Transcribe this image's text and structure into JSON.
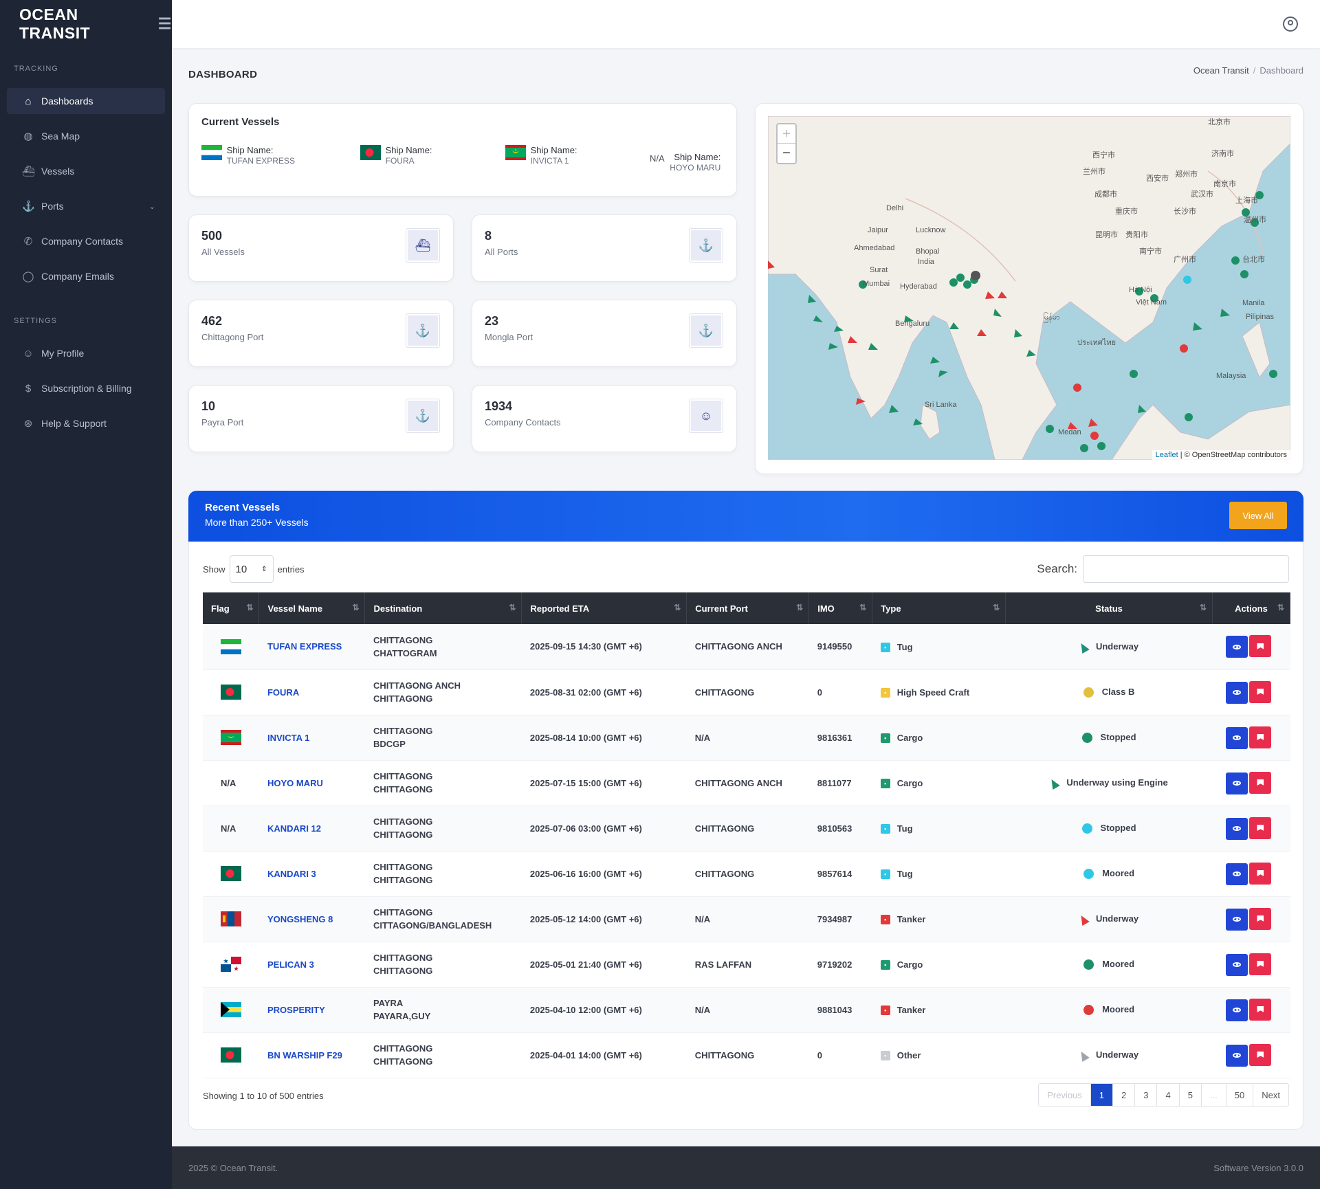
{
  "brand": {
    "name": "OCEAN TRANSIT"
  },
  "sidebar": {
    "sections": [
      {
        "title": "TRACKING"
      },
      {
        "title": "SETTINGS"
      }
    ],
    "tracking_items": [
      {
        "label": "Dashboards",
        "icon": "home-icon"
      },
      {
        "label": "Sea Map",
        "icon": "globe-icon"
      },
      {
        "label": "Vessels",
        "icon": "ship-icon"
      },
      {
        "label": "Ports",
        "icon": "anchor-icon"
      },
      {
        "label": "Company Contacts",
        "icon": "phone-icon"
      },
      {
        "label": "Company Emails",
        "icon": "chat-icon"
      }
    ],
    "settings_items": [
      {
        "label": "My Profile",
        "icon": "user-icon"
      },
      {
        "label": "Subscription & Billing",
        "icon": "dollar-icon"
      },
      {
        "label": "Help & Support",
        "icon": "lifebuoy-icon"
      }
    ]
  },
  "header": {
    "page_title": "DASHBOARD",
    "breadcrumb": [
      "Ocean Transit",
      "Dashboard"
    ]
  },
  "current_vessels": {
    "title": "Current Vessels",
    "ship_label": "Ship Name:",
    "items": [
      {
        "name": "TUFAN EXPRESS",
        "flag": "sierra-leone"
      },
      {
        "name": "FOURA",
        "flag": "bangladesh"
      },
      {
        "name": "INVICTA 1",
        "flag": "mauritania"
      },
      {
        "name": "HOYO MARU",
        "flag": "N/A"
      }
    ]
  },
  "stats": [
    {
      "value": "500",
      "label": "All Vessels",
      "icon": "ship-icon"
    },
    {
      "value": "8",
      "label": "All Ports",
      "icon": "anchor-icon"
    },
    {
      "value": "462",
      "label": "Chittagong Port",
      "icon": "anchor-icon"
    },
    {
      "value": "23",
      "label": "Mongla Port",
      "icon": "anchor-icon"
    },
    {
      "value": "10",
      "label": "Payra Port",
      "icon": "anchor-icon"
    },
    {
      "value": "1934",
      "label": "Company Contacts",
      "icon": "user-icon"
    }
  ],
  "map": {
    "zoom_in": "+",
    "zoom_out": "−",
    "attribution_link": "Leaflet",
    "attribution_text": " | © OpenStreetMap contributors",
    "labels": [
      "Delhi",
      "Jaipur",
      "Lucknow",
      "Ahmedabad",
      "Bhopal",
      "India",
      "Surat",
      "Mumbai",
      "Hyderabad",
      "Bengaluru",
      "Việt Nam",
      "Manila",
      "Pilipinas",
      "Malaysia",
      "成都市",
      "重庆市",
      "武汉市",
      "长沙市",
      "广州市",
      "南宁市",
      "昆明市",
      "贵阳市",
      "西安市",
      "郑州市",
      "北京市",
      "济南市",
      "南京市",
      "上海市",
      "温州市",
      "台北市",
      "兰州市",
      "西宁市",
      "Medan",
      "Sri Lanka",
      "Hà Nội",
      "ประเทศไทย",
      "မြန်မာ"
    ]
  },
  "recent": {
    "title": "Recent Vessels",
    "subtitle": "More than 250+ Vessels",
    "view_all": "View All",
    "show": "Show",
    "entries_value": "10",
    "entries": "entries",
    "search_label": "Search:",
    "columns": [
      "Flag",
      "Vessel Name",
      "Destination",
      "Reported ETA",
      "Current Port",
      "IMO",
      "Type",
      "Status",
      "Actions"
    ],
    "rows": [
      {
        "flag": "sierra-leone",
        "name": "TUFAN EXPRESS",
        "dest1": "CHITTAGONG",
        "dest2": "CHATTOGRAM",
        "eta": "2025-09-15 14:30 (GMT +6)",
        "port": "CHITTAGONG ANCH",
        "imo": "9149550",
        "type": "Tug",
        "type_color": "#2fc7e6",
        "status": "Underway",
        "status_kind": "arrow",
        "status_color": "#1f8f7a"
      },
      {
        "flag": "bangladesh",
        "name": "FOURA",
        "dest1": "CHITTAGONG ANCH",
        "dest2": "CHITTAGONG",
        "eta": "2025-08-31 02:00 (GMT +6)",
        "port": "CHITTAGONG",
        "imo": "0",
        "type": "High Speed Craft",
        "type_color": "#f2c53c",
        "status": "Class B",
        "status_kind": "dot",
        "status_color": "#e1c03e"
      },
      {
        "flag": "mauritania",
        "name": "INVICTA 1",
        "dest1": "CHITTAGONG",
        "dest2": "BDCGP",
        "eta": "2025-08-14 10:00 (GMT +6)",
        "port": "N/A",
        "imo": "9816361",
        "type": "Cargo",
        "type_color": "#1f9a6e",
        "status": "Stopped",
        "status_kind": "dot",
        "status_color": "#1e9068"
      },
      {
        "flag": "N/A",
        "name": "HOYO MARU",
        "dest1": "CHITTAGONG",
        "dest2": "CHITTAGONG",
        "eta": "2025-07-15 15:00 (GMT +6)",
        "port": "CHITTAGONG ANCH",
        "imo": "8811077",
        "type": "Cargo",
        "type_color": "#1f9a6e",
        "status": "Underway using Engine",
        "status_kind": "arrow",
        "status_color": "#1e9068"
      },
      {
        "flag": "N/A",
        "name": "KANDARI 12",
        "dest1": "CHITTAGONG",
        "dest2": "CHITTAGONG",
        "eta": "2025-07-06 03:00 (GMT +6)",
        "port": "CHITTAGONG",
        "imo": "9810563",
        "type": "Tug",
        "type_color": "#2fc7e6",
        "status": "Stopped",
        "status_kind": "dot",
        "status_color": "#2fc7e6"
      },
      {
        "flag": "bangladesh",
        "name": "KANDARI 3",
        "dest1": "CHITTAGONG",
        "dest2": "CHITTAGONG",
        "eta": "2025-06-16 16:00 (GMT +6)",
        "port": "CHITTAGONG",
        "imo": "9857614",
        "type": "Tug",
        "type_color": "#2fc7e6",
        "status": "Moored",
        "status_kind": "dot",
        "status_color": "#2fc7e6"
      },
      {
        "flag": "mongolia",
        "name": "YONGSHENG 8",
        "dest1": "CHITTAGONG",
        "dest2": "CITTAGONG/BANGLADESH",
        "eta": "2025-05-12 14:00 (GMT +6)",
        "port": "N/A",
        "imo": "7934987",
        "type": "Tanker",
        "type_color": "#e13a3a",
        "status": "Underway",
        "status_kind": "arrow",
        "status_color": "#e13a3a"
      },
      {
        "flag": "panama",
        "name": "PELICAN 3",
        "dest1": "CHITTAGONG",
        "dest2": "CHITTAGONG",
        "eta": "2025-05-01 21:40 (GMT +6)",
        "port": "RAS LAFFAN",
        "imo": "9719202",
        "type": "Cargo",
        "type_color": "#1f9a6e",
        "status": "Moored",
        "status_kind": "dot",
        "status_color": "#1e9068"
      },
      {
        "flag": "bahamas",
        "name": "PROSPERITY",
        "dest1": "PAYRA",
        "dest2": "PAYARA,GUY",
        "eta": "2025-04-10 12:00 (GMT +6)",
        "port": "N/A",
        "imo": "9881043",
        "type": "Tanker",
        "type_color": "#e13a3a",
        "status": "Moored",
        "status_kind": "dot",
        "status_color": "#e13a3a"
      },
      {
        "flag": "bangladesh",
        "name": "BN WARSHIP F29",
        "dest1": "CHITTAGONG",
        "dest2": "CHITTAGONG",
        "eta": "2025-04-01 14:00 (GMT +6)",
        "port": "CHITTAGONG",
        "imo": "0",
        "type": "Other",
        "type_color": "#c9ccd3",
        "status": "Underway",
        "status_kind": "arrow",
        "status_color": "#9ea3ad"
      }
    ],
    "info": "Showing 1 to 10 of 500 entries",
    "pager": [
      "Previous",
      "1",
      "2",
      "3",
      "4",
      "5",
      "...",
      "50",
      "Next"
    ]
  },
  "footer": {
    "left": "2025 © Ocean Transit.",
    "right": "Software Version 3.0.0"
  }
}
